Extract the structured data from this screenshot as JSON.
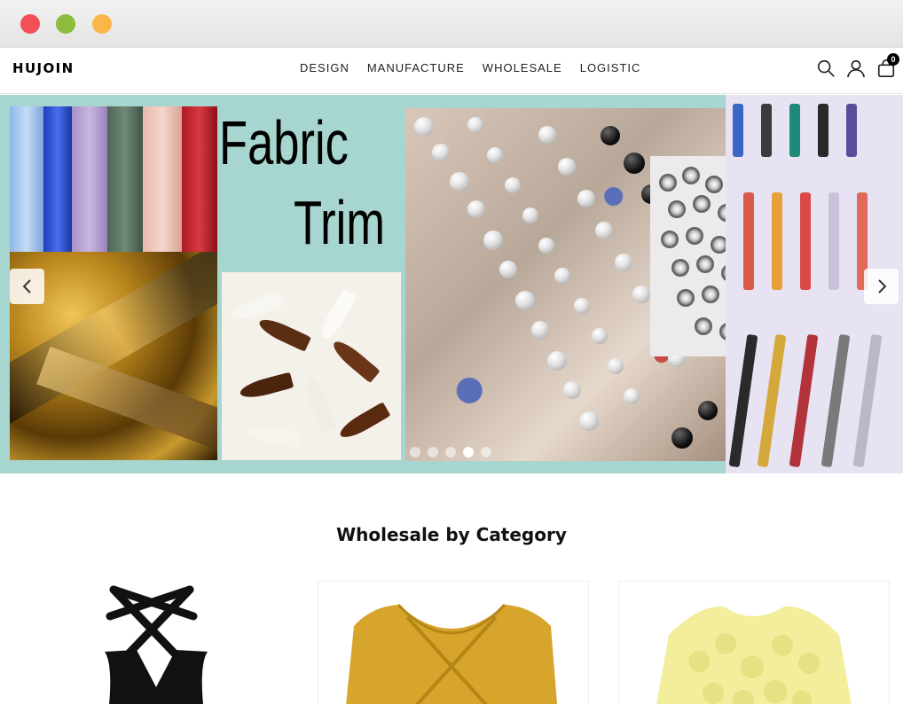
{
  "window": {
    "controls": [
      "close",
      "minimize",
      "zoom"
    ]
  },
  "header": {
    "logo": "HUJOIN",
    "nav": [
      "DESIGN",
      "MANUFACTURE",
      "WHOLESALE",
      "LOGISTIC"
    ],
    "icons": [
      "search-icon",
      "user-icon",
      "cart-icon"
    ],
    "cart_count": "0"
  },
  "hero": {
    "line1": "Fabric",
    "line2": "Trim",
    "slides_total": 5,
    "active_slide": 4,
    "prev_icon": "chevron-left-icon",
    "next_icon": "chevron-right-icon"
  },
  "categories": {
    "title": "Wholesale by Category",
    "items": [
      "black strappy top",
      "mustard criss-cross top",
      "yellow ruffle sweater"
    ]
  },
  "colors": {
    "background": "#ffffff",
    "hero_bg": "#a7d6d0",
    "text": "#111111"
  }
}
